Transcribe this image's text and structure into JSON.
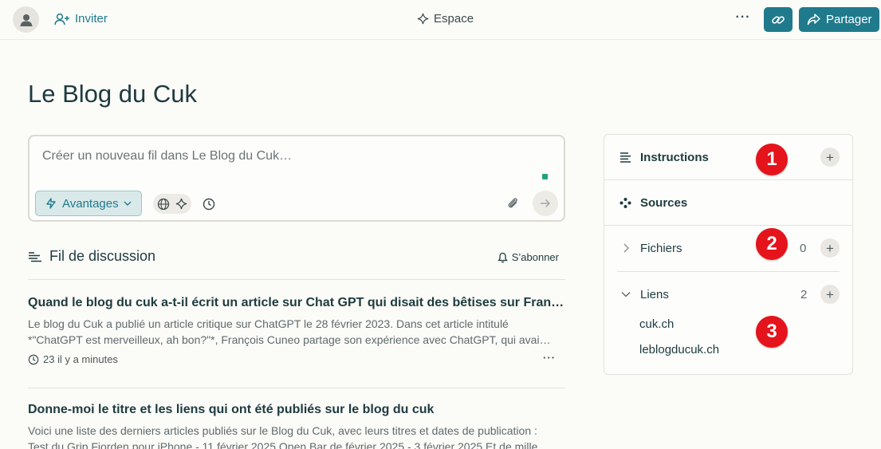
{
  "topbar": {
    "invite_label": "Inviter",
    "space_label": "Espace",
    "more_label": "···",
    "share_label": "Partager"
  },
  "page": {
    "title": "Le Blog du Cuk"
  },
  "composer": {
    "placeholder": "Créer un nouveau fil dans Le Blog du Cuk…",
    "mode_label": "Avantages"
  },
  "feed": {
    "title": "Fil de discussion",
    "subscribe_label": "S’abonner",
    "threads": [
      {
        "title": "Quand le blog du cuk a-t-il écrit un article sur Chat GPT qui disait des bêtises sur Fran…",
        "snippet_line1": "Le blog du Cuk a publié un article critique sur ChatGPT le 28 février 2023. Dans cet article intitulé",
        "snippet_line2": "*\"ChatGPT est merveilleux, ah bon?\"*, François Cuneo partage son expérience avec ChatGPT, qui avai…",
        "meta": "23 il y a minutes",
        "more": "···"
      },
      {
        "title": "Donne-moi le titre et les liens qui ont été publiés sur le blog du cuk",
        "snippet_line1": "Voici une liste des derniers articles publiés sur le Blog du Cuk, avec leurs titres et dates de publication :",
        "snippet_line2": "Test du Grip Fjorden pour iPhone - 11 février 2025 Open Bar de février 2025 - 3 février 2025 Et de mille…"
      }
    ]
  },
  "panel": {
    "instructions_label": "Instructions",
    "sources_label": "Sources",
    "files_label": "Fichiers",
    "files_count": "0",
    "links_label": "Liens",
    "links_count": "2",
    "links": [
      "cuk.ch",
      "leblogducuk.ch"
    ]
  },
  "badges": [
    "1",
    "2",
    "3"
  ],
  "colors": {
    "accent": "#1f7a8c",
    "badge": "#e5131b",
    "status_dot": "#20a37a"
  }
}
